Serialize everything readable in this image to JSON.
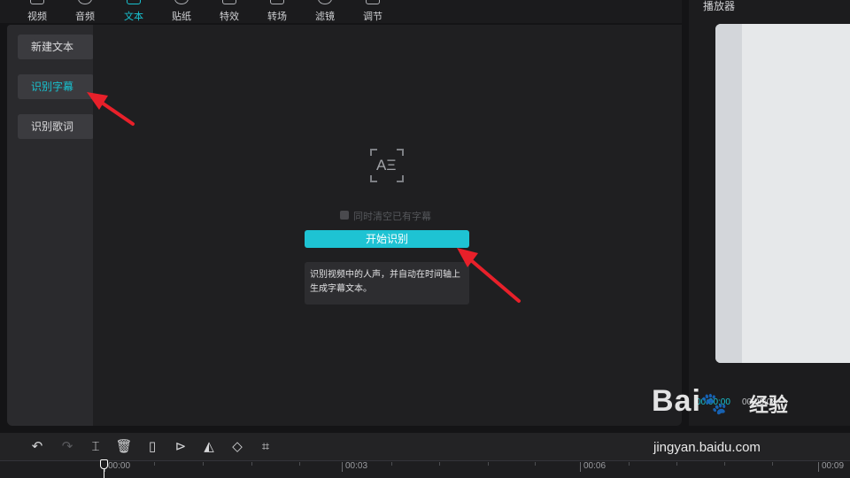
{
  "topbar": {
    "tabs": [
      {
        "label": "视频",
        "icon": "video-icon"
      },
      {
        "label": "音频",
        "icon": "audio-icon"
      },
      {
        "label": "文本",
        "icon": "text-icon",
        "active": true
      },
      {
        "label": "贴纸",
        "icon": "sticker-icon"
      },
      {
        "label": "特效",
        "icon": "effects-icon"
      },
      {
        "label": "转场",
        "icon": "transition-icon"
      },
      {
        "label": "滤镜",
        "icon": "filter-icon"
      },
      {
        "label": "调节",
        "icon": "adjust-icon"
      }
    ]
  },
  "sidebar": {
    "items": [
      {
        "label": "新建文本"
      },
      {
        "label": "识别字幕",
        "active": true
      },
      {
        "label": "识别歌词"
      }
    ]
  },
  "main": {
    "icon_text": "AΞ",
    "clear_checkbox_label": "同时清空已有字幕",
    "start_button": "开始识别",
    "hint_line1": "识别视频中的人声，并自动在时间轴上",
    "hint_line2": "生成字幕文本。"
  },
  "player": {
    "title": "播放器",
    "current_time": "00:00:00",
    "total_time": "00:00:08"
  },
  "timeline": {
    "toolbar": [
      "undo-icon",
      "redo-icon",
      "split-icon",
      "delete-icon",
      "freeze-frame-icon",
      "reverse-icon",
      "mirror-icon",
      "rotate-icon",
      "crop-icon"
    ],
    "ticks": [
      "00:00",
      "00:03",
      "00:06",
      "00:09"
    ]
  },
  "watermark": {
    "logo": "Bai",
    "logo_suffix": "经验",
    "url": "jingyan.baidu.com"
  },
  "colors": {
    "accent": "#1ec3d3",
    "annotation_arrow": "#e8202a",
    "background": "#1f1f21"
  }
}
